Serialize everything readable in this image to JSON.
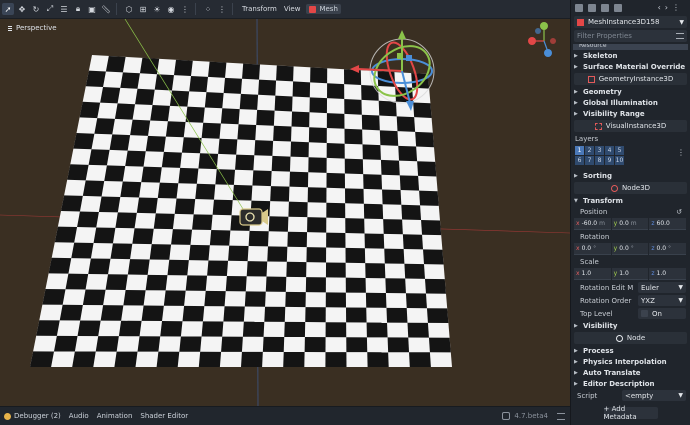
{
  "toolbar": {
    "transform_label": "Transform",
    "view_label": "View",
    "mesh_label": "Mesh",
    "icons": [
      "select-icon",
      "move-icon",
      "rotate-icon",
      "scale-icon",
      "list-select-icon",
      "lock-icon",
      "group-icon",
      "ruler-icon",
      "snap-icon",
      "local-space-icon",
      "sun-icon",
      "environment-icon",
      "more-icon"
    ]
  },
  "viewport": {
    "perspective_label": "Perspective",
    "gizmo_axes": [
      "X",
      "Y",
      "Z"
    ],
    "checker_rows": 20,
    "checker_cols": 20
  },
  "bottom_bar": {
    "debugger_label": "Debugger (2)",
    "audio_label": "Audio",
    "animation_label": "Animation",
    "shader_editor_label": "Shader Editor",
    "version_label": "4.7.beta4"
  },
  "inspector": {
    "node_name": "MeshInstance3D158",
    "filter_placeholder": "Filter Properties",
    "resource_label": "Resource",
    "sections_top": [
      "Skeleton",
      "Surface Material Override"
    ],
    "class_geometry_instance": "GeometryInstance3D",
    "sections_geo": [
      "Geometry",
      "Global Illumination",
      "Visibility Range"
    ],
    "class_visual_instance": "VisualInstance3D",
    "layers_label": "Layers",
    "layers": [
      "1",
      "2",
      "3",
      "4",
      "5",
      "6",
      "7",
      "8",
      "9",
      "10"
    ],
    "sorting_label": "Sorting",
    "class_node3d": "Node3D",
    "transform_label": "Transform",
    "position_label": "Position",
    "position": {
      "x": "-60.0",
      "y": "0.0",
      "z": "60.0",
      "unit": "m"
    },
    "rotation_label": "Rotation",
    "rotation": {
      "x": "0.0",
      "y": "0.0",
      "z": "0.0",
      "unit": "°"
    },
    "scale_label": "Scale",
    "scale": {
      "x": "1.0",
      "y": "1.0",
      "z": "1.0"
    },
    "rotation_edit_mode_label": "Rotation Edit M",
    "rotation_edit_mode_value": "Euler",
    "rotation_order_label": "Rotation Order",
    "rotation_order_value": "YXZ",
    "top_level_label": "Top Level",
    "top_level_value": "On",
    "visibility_label": "Visibility",
    "class_node": "Node",
    "sections_node": [
      "Process",
      "Physics Interpolation",
      "Auto Translate",
      "Editor Description"
    ],
    "script_label": "Script",
    "script_value": "<empty",
    "add_metadata_label": "+ Add Metadata"
  },
  "colors": {
    "viewport_bg": "#3a2f22",
    "axis_red": "#b83b3b",
    "axis_green": "#8bc34a",
    "axis_blue": "#3f6fc6",
    "mesh_accent": "#e34747"
  }
}
